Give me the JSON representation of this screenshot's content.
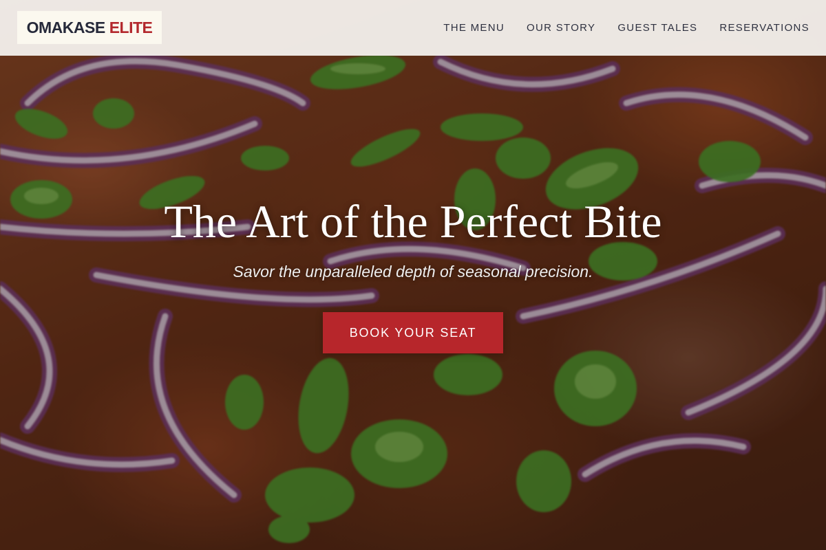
{
  "brand": {
    "name_part1": "OMAKASE",
    "name_part2": "ELITE"
  },
  "nav": {
    "items": [
      {
        "label": "THE MENU"
      },
      {
        "label": "OUR STORY"
      },
      {
        "label": "GUEST TALES"
      },
      {
        "label": "RESERVATIONS"
      }
    ]
  },
  "hero": {
    "title": "The Art of the Perfect Bite",
    "subtitle": "Savor the unparalleled depth of seasonal precision.",
    "cta_label": "BOOK YOUR SEAT",
    "background": "hero-food-image"
  },
  "colors": {
    "accent": "#b7262b",
    "logo_dark": "#26293a",
    "header_bg": "#f7f5f2"
  }
}
